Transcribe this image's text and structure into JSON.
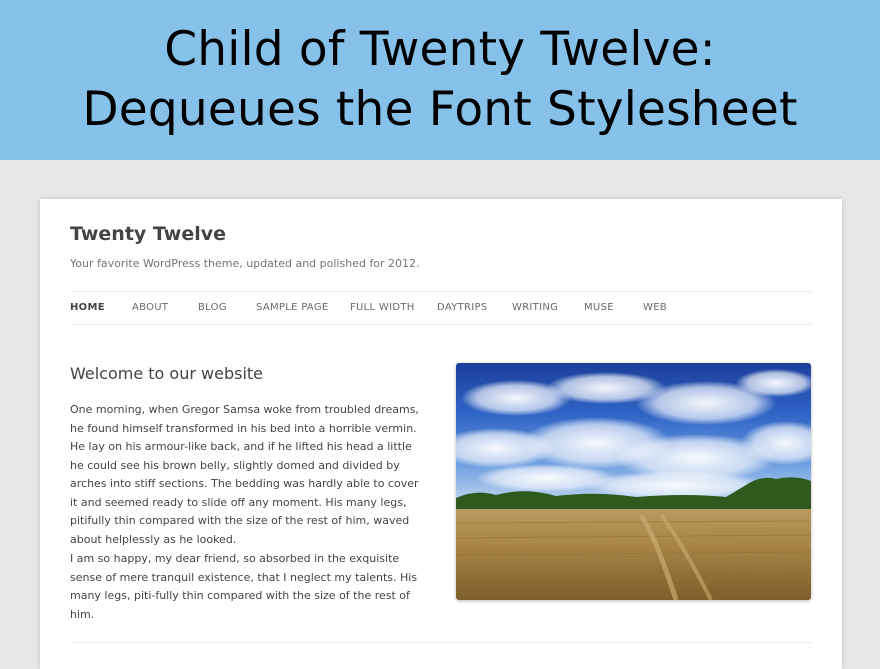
{
  "banner": {
    "line1": "Child of Twenty Twelve:",
    "line2": "Dequeues the Font Stylesheet"
  },
  "site": {
    "title": "Twenty Twelve",
    "description": "Your favorite WordPress theme, updated and polished for 2012."
  },
  "nav": {
    "items": [
      "HOME",
      "ABOUT",
      "BLOG",
      "SAMPLE PAGE",
      "FULL WIDTH",
      "DAYTRIPS",
      "WRITING",
      "MUSE",
      "WEB"
    ],
    "current": "HOME"
  },
  "entry": {
    "title": "Welcome to our website",
    "paragraph1": "One morning, when Gregor Samsa woke from troubled dreams, he found himself transformed in his bed into a horrible vermin. He lay on his armour-like back, and if he lifted his head a little he could see his brown belly, slightly domed and divided by arches into stiff sections. The bedding was hardly able to cover it and seemed ready to slide off any moment. His many legs, pitifully thin compared with the size of the rest of him, waved about helplessly as he looked.",
    "paragraph2": "I am so happy, my dear friend, so absorbed in the exquisite sense of mere tranquil existence, that I neglect my talents. His many legs, piti-fully thin compared with the size of the rest of him.",
    "image": "wheat-field-under-blue-sky-photo"
  },
  "colors": {
    "banner": "#86c1e9",
    "page_background": "#e6e6e6",
    "text": "#444444"
  }
}
